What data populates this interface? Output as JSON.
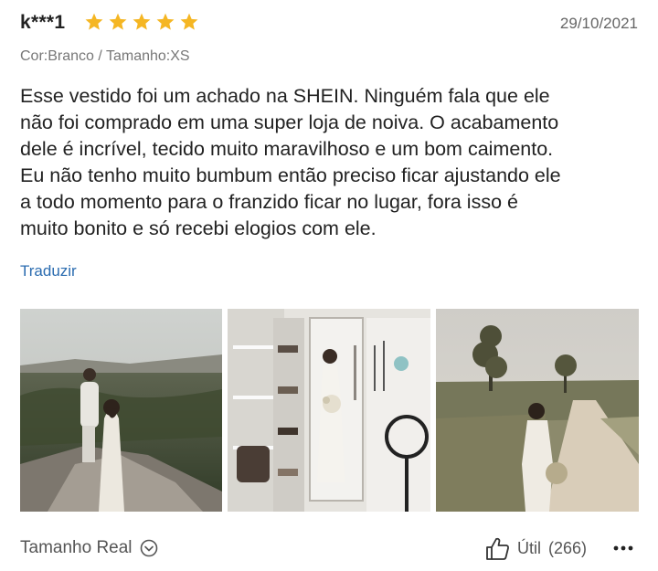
{
  "review": {
    "username": "k***1",
    "rating": 5,
    "rating_max": 5,
    "star_color": "#f5b623",
    "date": "29/10/2021",
    "variant": "Cor:Branco / Tamanho:XS",
    "text_lines": [
      "Esse vestido foi um achado na SHEIN. Ninguém fala que ele",
      "não foi comprado em uma super loja de noiva. O acabamento",
      "dele é incrível, tecido muito maravilhoso e um bom caimento.",
      "Eu não tenho muito bumbum então preciso ficar ajustando ele",
      "a todo momento para o franzido ficar no lugar, fora isso é",
      "muito bonito e só recebi elogios com ele."
    ],
    "translate_label": "Traduzir",
    "link_color": "#2b6cb0"
  },
  "photos": [
    {
      "icon": "photo-couple-cliff"
    },
    {
      "icon": "photo-mirror-selfie"
    },
    {
      "icon": "photo-dirt-road"
    }
  ],
  "footer": {
    "fit_label": "Tamanho Real",
    "fit_icon": "chevron-down-circle-icon",
    "helpful_label": "Útil",
    "helpful_count": "(266)",
    "helpful_icon": "thumbs-up-icon",
    "more_icon": "more-dots-icon"
  }
}
